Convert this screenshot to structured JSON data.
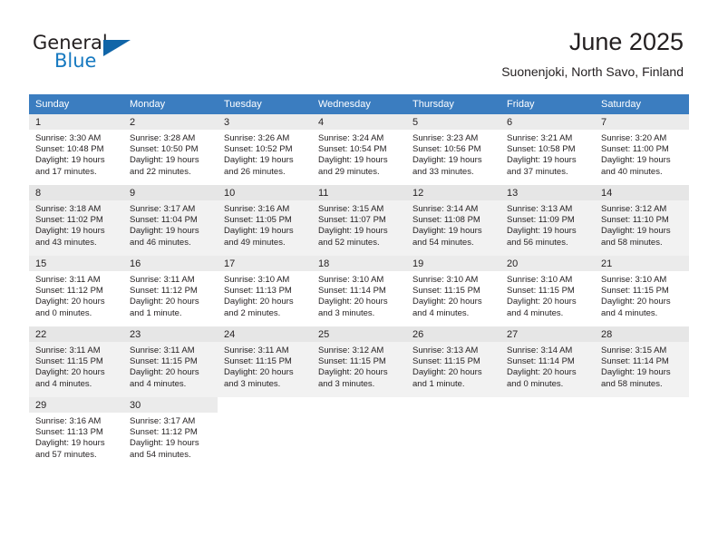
{
  "logo": {
    "word_general": "General",
    "word_blue": "Blue",
    "triangle_color": "#1065a8",
    "blue_color": "#1679c0"
  },
  "header": {
    "title": "June 2025",
    "subtitle": "Suonenjoki, North Savo, Finland"
  },
  "theme": {
    "header_row_bg": "#3b7dc0",
    "header_row_text": "#ffffff",
    "shaded_row_bg": "#f2f2f2",
    "daynum_band_bg": "#ebebeb",
    "text_color": "#231f20"
  },
  "calendar": {
    "weekday_headers": [
      "Sunday",
      "Monday",
      "Tuesday",
      "Wednesday",
      "Thursday",
      "Friday",
      "Saturday"
    ],
    "labels": {
      "sunrise": "Sunrise:",
      "sunset": "Sunset:",
      "daylight": "Daylight:"
    },
    "weeks": [
      {
        "shaded": false,
        "days": [
          {
            "day": "1",
            "sunrise": "Sunrise: 3:30 AM",
            "sunset": "Sunset: 10:48 PM",
            "daylight_line1": "Daylight: 19 hours",
            "daylight_line2": "and 17 minutes."
          },
          {
            "day": "2",
            "sunrise": "Sunrise: 3:28 AM",
            "sunset": "Sunset: 10:50 PM",
            "daylight_line1": "Daylight: 19 hours",
            "daylight_line2": "and 22 minutes."
          },
          {
            "day": "3",
            "sunrise": "Sunrise: 3:26 AM",
            "sunset": "Sunset: 10:52 PM",
            "daylight_line1": "Daylight: 19 hours",
            "daylight_line2": "and 26 minutes."
          },
          {
            "day": "4",
            "sunrise": "Sunrise: 3:24 AM",
            "sunset": "Sunset: 10:54 PM",
            "daylight_line1": "Daylight: 19 hours",
            "daylight_line2": "and 29 minutes."
          },
          {
            "day": "5",
            "sunrise": "Sunrise: 3:23 AM",
            "sunset": "Sunset: 10:56 PM",
            "daylight_line1": "Daylight: 19 hours",
            "daylight_line2": "and 33 minutes."
          },
          {
            "day": "6",
            "sunrise": "Sunrise: 3:21 AM",
            "sunset": "Sunset: 10:58 PM",
            "daylight_line1": "Daylight: 19 hours",
            "daylight_line2": "and 37 minutes."
          },
          {
            "day": "7",
            "sunrise": "Sunrise: 3:20 AM",
            "sunset": "Sunset: 11:00 PM",
            "daylight_line1": "Daylight: 19 hours",
            "daylight_line2": "and 40 minutes."
          }
        ]
      },
      {
        "shaded": true,
        "days": [
          {
            "day": "8",
            "sunrise": "Sunrise: 3:18 AM",
            "sunset": "Sunset: 11:02 PM",
            "daylight_line1": "Daylight: 19 hours",
            "daylight_line2": "and 43 minutes."
          },
          {
            "day": "9",
            "sunrise": "Sunrise: 3:17 AM",
            "sunset": "Sunset: 11:04 PM",
            "daylight_line1": "Daylight: 19 hours",
            "daylight_line2": "and 46 minutes."
          },
          {
            "day": "10",
            "sunrise": "Sunrise: 3:16 AM",
            "sunset": "Sunset: 11:05 PM",
            "daylight_line1": "Daylight: 19 hours",
            "daylight_line2": "and 49 minutes."
          },
          {
            "day": "11",
            "sunrise": "Sunrise: 3:15 AM",
            "sunset": "Sunset: 11:07 PM",
            "daylight_line1": "Daylight: 19 hours",
            "daylight_line2": "and 52 minutes."
          },
          {
            "day": "12",
            "sunrise": "Sunrise: 3:14 AM",
            "sunset": "Sunset: 11:08 PM",
            "daylight_line1": "Daylight: 19 hours",
            "daylight_line2": "and 54 minutes."
          },
          {
            "day": "13",
            "sunrise": "Sunrise: 3:13 AM",
            "sunset": "Sunset: 11:09 PM",
            "daylight_line1": "Daylight: 19 hours",
            "daylight_line2": "and 56 minutes."
          },
          {
            "day": "14",
            "sunrise": "Sunrise: 3:12 AM",
            "sunset": "Sunset: 11:10 PM",
            "daylight_line1": "Daylight: 19 hours",
            "daylight_line2": "and 58 minutes."
          }
        ]
      },
      {
        "shaded": false,
        "days": [
          {
            "day": "15",
            "sunrise": "Sunrise: 3:11 AM",
            "sunset": "Sunset: 11:12 PM",
            "daylight_line1": "Daylight: 20 hours",
            "daylight_line2": "and 0 minutes."
          },
          {
            "day": "16",
            "sunrise": "Sunrise: 3:11 AM",
            "sunset": "Sunset: 11:12 PM",
            "daylight_line1": "Daylight: 20 hours",
            "daylight_line2": "and 1 minute."
          },
          {
            "day": "17",
            "sunrise": "Sunrise: 3:10 AM",
            "sunset": "Sunset: 11:13 PM",
            "daylight_line1": "Daylight: 20 hours",
            "daylight_line2": "and 2 minutes."
          },
          {
            "day": "18",
            "sunrise": "Sunrise: 3:10 AM",
            "sunset": "Sunset: 11:14 PM",
            "daylight_line1": "Daylight: 20 hours",
            "daylight_line2": "and 3 minutes."
          },
          {
            "day": "19",
            "sunrise": "Sunrise: 3:10 AM",
            "sunset": "Sunset: 11:15 PM",
            "daylight_line1": "Daylight: 20 hours",
            "daylight_line2": "and 4 minutes."
          },
          {
            "day": "20",
            "sunrise": "Sunrise: 3:10 AM",
            "sunset": "Sunset: 11:15 PM",
            "daylight_line1": "Daylight: 20 hours",
            "daylight_line2": "and 4 minutes."
          },
          {
            "day": "21",
            "sunrise": "Sunrise: 3:10 AM",
            "sunset": "Sunset: 11:15 PM",
            "daylight_line1": "Daylight: 20 hours",
            "daylight_line2": "and 4 minutes."
          }
        ]
      },
      {
        "shaded": true,
        "days": [
          {
            "day": "22",
            "sunrise": "Sunrise: 3:11 AM",
            "sunset": "Sunset: 11:15 PM",
            "daylight_line1": "Daylight: 20 hours",
            "daylight_line2": "and 4 minutes."
          },
          {
            "day": "23",
            "sunrise": "Sunrise: 3:11 AM",
            "sunset": "Sunset: 11:15 PM",
            "daylight_line1": "Daylight: 20 hours",
            "daylight_line2": "and 4 minutes."
          },
          {
            "day": "24",
            "sunrise": "Sunrise: 3:11 AM",
            "sunset": "Sunset: 11:15 PM",
            "daylight_line1": "Daylight: 20 hours",
            "daylight_line2": "and 3 minutes."
          },
          {
            "day": "25",
            "sunrise": "Sunrise: 3:12 AM",
            "sunset": "Sunset: 11:15 PM",
            "daylight_line1": "Daylight: 20 hours",
            "daylight_line2": "and 3 minutes."
          },
          {
            "day": "26",
            "sunrise": "Sunrise: 3:13 AM",
            "sunset": "Sunset: 11:15 PM",
            "daylight_line1": "Daylight: 20 hours",
            "daylight_line2": "and 1 minute."
          },
          {
            "day": "27",
            "sunrise": "Sunrise: 3:14 AM",
            "sunset": "Sunset: 11:14 PM",
            "daylight_line1": "Daylight: 20 hours",
            "daylight_line2": "and 0 minutes."
          },
          {
            "day": "28",
            "sunrise": "Sunrise: 3:15 AM",
            "sunset": "Sunset: 11:14 PM",
            "daylight_line1": "Daylight: 19 hours",
            "daylight_line2": "and 58 minutes."
          }
        ]
      },
      {
        "shaded": false,
        "days": [
          {
            "day": "29",
            "sunrise": "Sunrise: 3:16 AM",
            "sunset": "Sunset: 11:13 PM",
            "daylight_line1": "Daylight: 19 hours",
            "daylight_line2": "and 57 minutes."
          },
          {
            "day": "30",
            "sunrise": "Sunrise: 3:17 AM",
            "sunset": "Sunset: 11:12 PM",
            "daylight_line1": "Daylight: 19 hours",
            "daylight_line2": "and 54 minutes."
          },
          null,
          null,
          null,
          null,
          null
        ]
      }
    ]
  }
}
